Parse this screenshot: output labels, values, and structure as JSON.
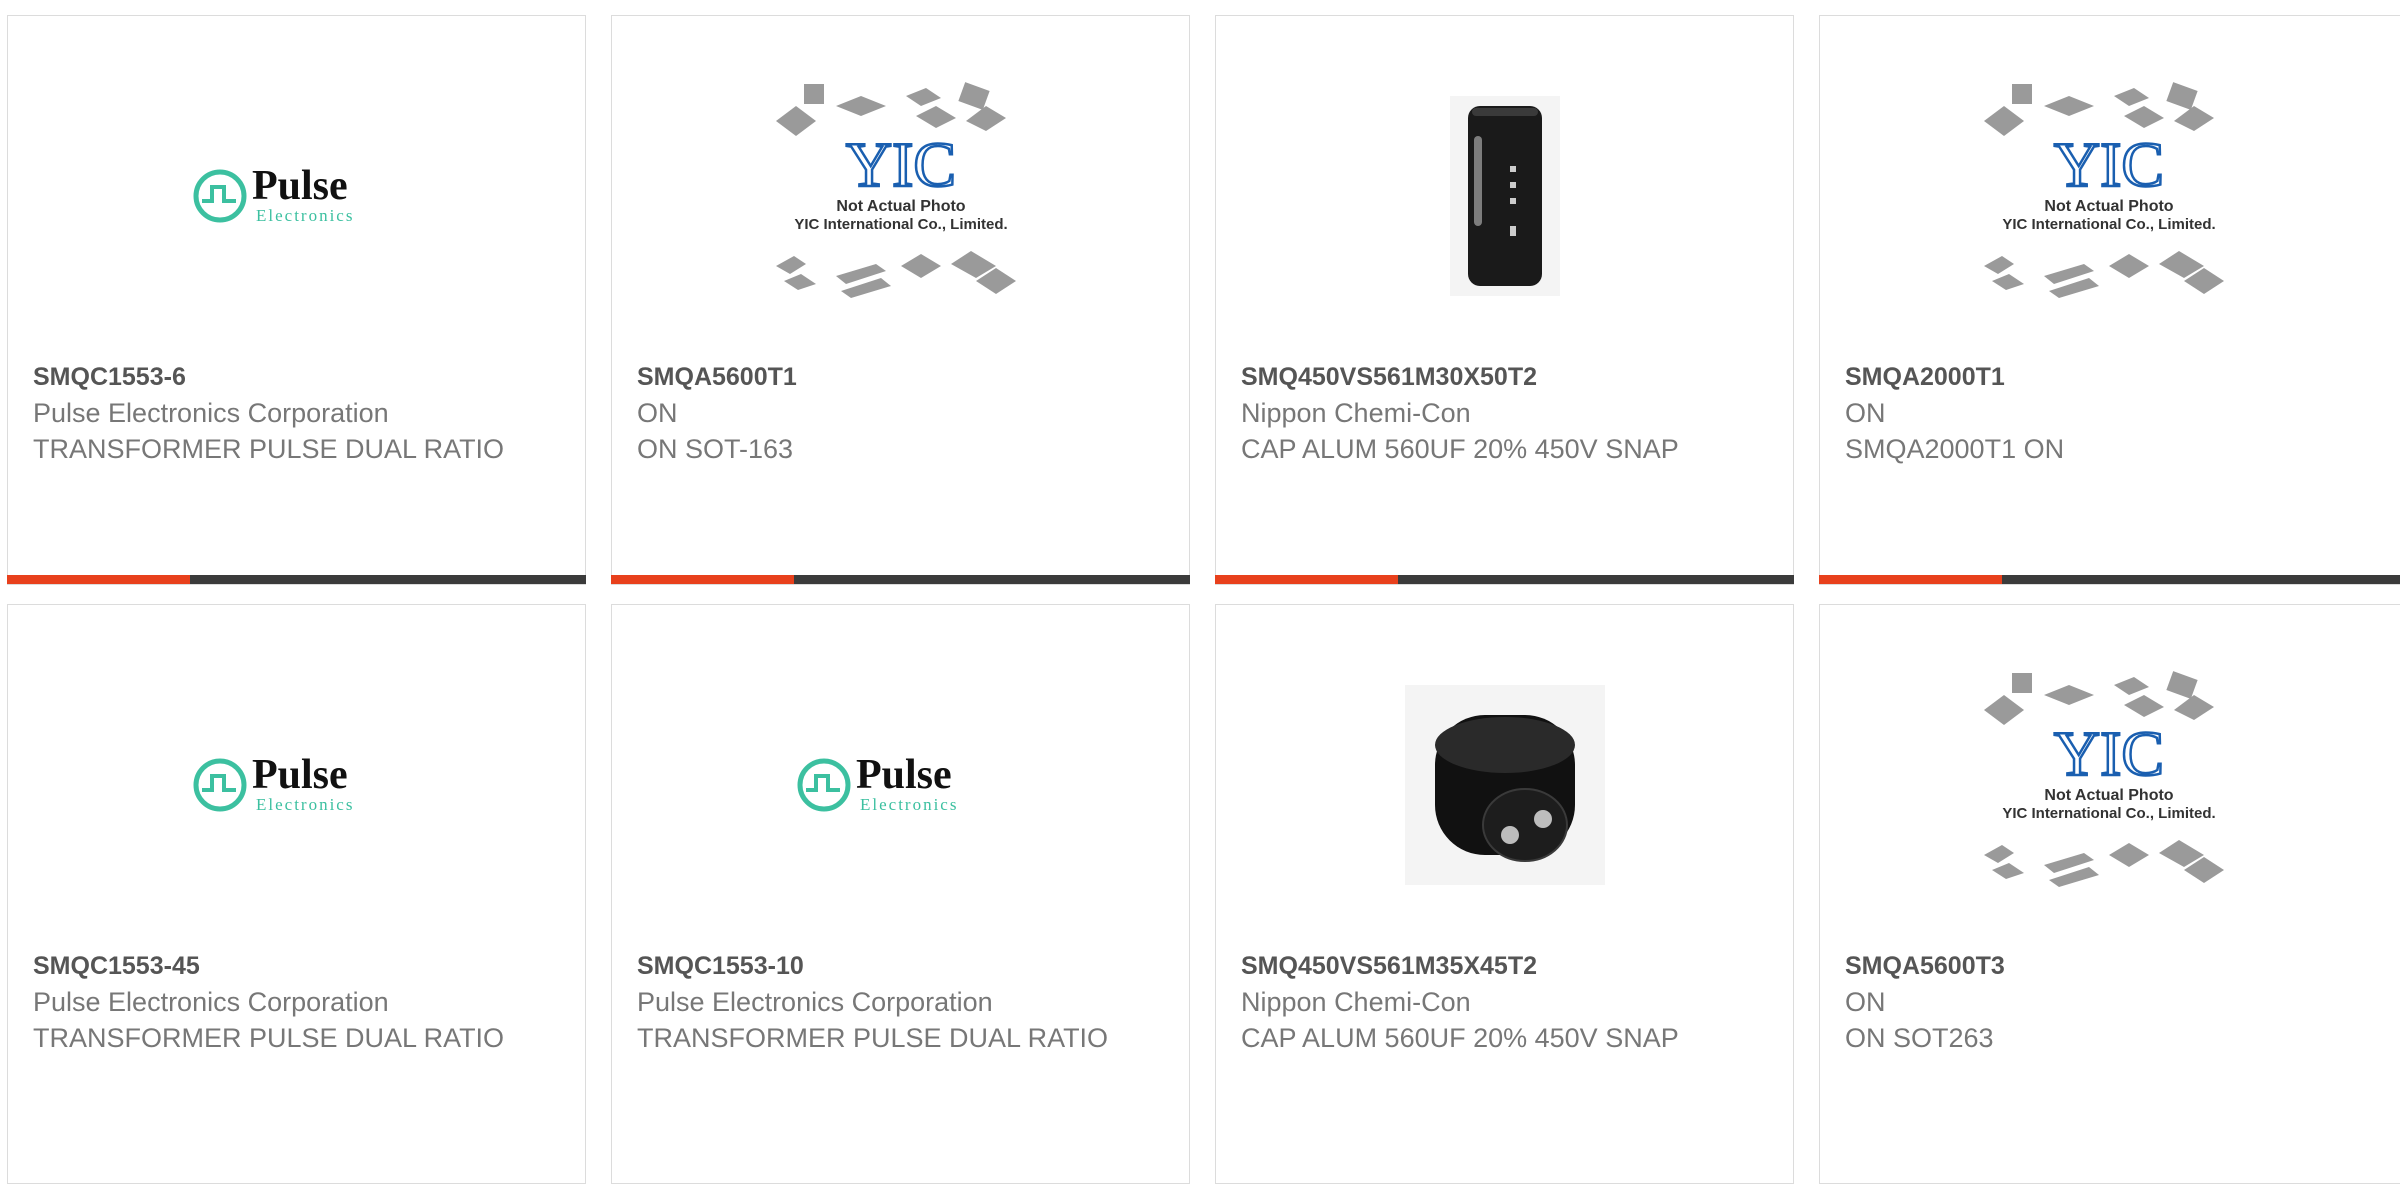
{
  "accent_color": "#e8401c",
  "logos": {
    "pulse_word": "Pulse",
    "pulse_sub": "Electronics",
    "yic_mark": "YIC",
    "yic_line1": "Not Actual Photo",
    "yic_line2": "YIC International Co., Limited."
  },
  "products": [
    {
      "pn": "SMQC1553-6",
      "mfr": "Pulse Electronics Corporation",
      "desc": "TRANSFORMER PULSE DUAL RATIO",
      "image": "pulse-logo"
    },
    {
      "pn": "SMQA5600T1",
      "mfr": "ON",
      "desc": "ON SOT-163",
      "image": "yic-placeholder"
    },
    {
      "pn": "SMQ450VS561M30X50T2",
      "mfr": "Nippon Chemi-Con",
      "desc": "CAP ALUM 560UF 20% 450V SNAP",
      "image": "capacitor-side-photo"
    },
    {
      "pn": "SMQA2000T1",
      "mfr": "ON",
      "desc": "SMQA2000T1 ON",
      "image": "yic-placeholder"
    },
    {
      "pn": "SMQC1553-45",
      "mfr": "Pulse Electronics Corporation",
      "desc": "TRANSFORMER PULSE DUAL RATIO",
      "image": "pulse-logo"
    },
    {
      "pn": "SMQC1553-10",
      "mfr": "Pulse Electronics Corporation",
      "desc": "TRANSFORMER PULSE DUAL RATIO",
      "image": "pulse-logo"
    },
    {
      "pn": "SMQ450VS561M35X45T2",
      "mfr": "Nippon Chemi-Con",
      "desc": "CAP ALUM 560UF 20% 450V SNAP",
      "image": "capacitor-top-photo"
    },
    {
      "pn": "SMQA5600T3",
      "mfr": "ON",
      "desc": "ON SOT263",
      "image": "yic-placeholder"
    }
  ]
}
